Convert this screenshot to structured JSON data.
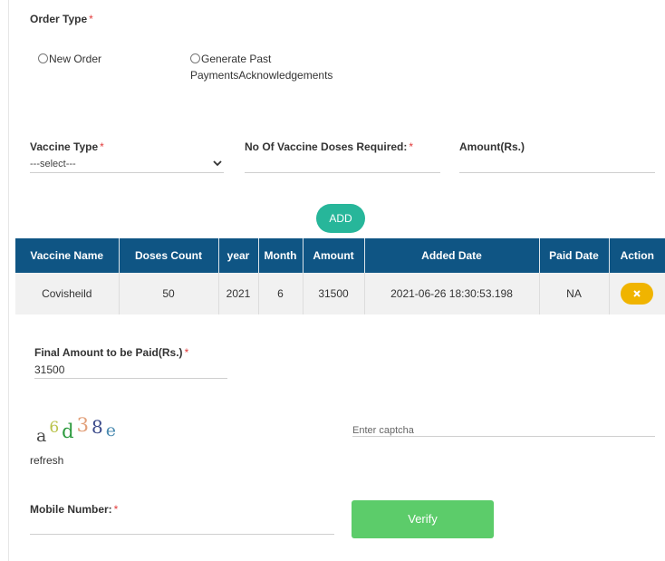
{
  "order_type": {
    "label": "Order Type",
    "required_mark": "*",
    "options": [
      {
        "label": "New Order",
        "selected": false
      },
      {
        "label": "Generate Past",
        "label_line2": "PaymentsAcknowledgements",
        "selected": false
      }
    ]
  },
  "vaccine_type": {
    "label": "Vaccine Type",
    "required_mark": "*",
    "selected": "---select---"
  },
  "doses": {
    "label": "No Of Vaccine Doses Required:",
    "required_mark": "*",
    "value": ""
  },
  "amount": {
    "label": "Amount(Rs.)",
    "value": ""
  },
  "add_button": "ADD",
  "table": {
    "headers": [
      "Vaccine Name",
      "Doses Count",
      "year",
      "Month",
      "Amount",
      "Added Date",
      "Paid Date",
      "Action"
    ],
    "rows": [
      {
        "vaccine_name": "Covisheild",
        "doses_count": "50",
        "year": "2021",
        "month": "6",
        "amount": "31500",
        "added_date": "2021-06-26 18:30:53.198",
        "paid_date": "NA",
        "action_icon": "close-icon"
      }
    ]
  },
  "final_amount": {
    "label": "Final Amount to be Paid(Rs.)",
    "required_mark": "*",
    "value": "31500"
  },
  "captcha": {
    "chars": [
      {
        "ch": "a",
        "color": "#4a4a4a"
      },
      {
        "ch": "6",
        "color": "#b9c24a"
      },
      {
        "ch": "d",
        "color": "#2c9a3e"
      },
      {
        "ch": "3",
        "color": "#e2a07a"
      },
      {
        "ch": "8",
        "color": "#3b4a8a"
      },
      {
        "ch": "e",
        "color": "#4a8ab0"
      }
    ],
    "refresh_label": "refresh",
    "input_placeholder": "Enter captcha"
  },
  "mobile": {
    "label": "Mobile Number:",
    "required_mark": "*",
    "value": ""
  },
  "verify_button": "Verify",
  "colors": {
    "header_bg": "#0f5584",
    "add_btn": "#27b69a",
    "action_btn": "#f0b400",
    "verify_btn": "#5ccc6a",
    "required": "#e23b3b"
  }
}
